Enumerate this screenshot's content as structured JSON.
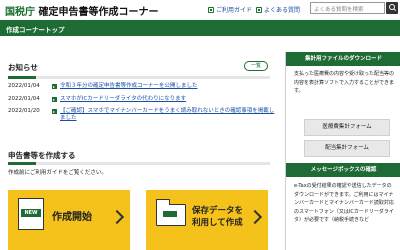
{
  "header": {
    "agency": "国税庁",
    "site_title": "確定申告書等作成コーナー",
    "guide_link": "ご利用ガイド",
    "faq_link": "よくある質問",
    "search_placeholder": "よくある質問を検索"
  },
  "topbar": {
    "title": "作成コーナートップ"
  },
  "news": {
    "heading": "お知らせ",
    "list_button": "一覧",
    "items": [
      {
        "date": "2022/01/04",
        "text": "令和３年分の確定申告書等作成コーナーを公開しました"
      },
      {
        "date": "2022/01/04",
        "text": "スマホがICカードリーダライタの代わりになります"
      },
      {
        "date": "2022/01/20",
        "text": "【ご確認】スマホでマイナンバーカードをうまく読み取れないときの確認事項を掲載しました"
      }
    ]
  },
  "create": {
    "heading": "申告書等を作成する",
    "subtext": "作成前にご利用ガイドをご覧ください。",
    "tile_start": "作成開始",
    "tile_start_icon_text": "NEW",
    "tile_saved_line1": "保存データを",
    "tile_saved_line2": "利用して作成"
  },
  "sidebar": {
    "download_heading": "集計用ファイルのダウンロード",
    "download_text": "支払った医療費の内容や受け取った配当等の内容を表計算ソフトで入力することができます。",
    "btn_medical": "医療費集計フォーム",
    "btn_dividend": "配当集計フォーム",
    "message_heading": "メッセージボックスの確認",
    "message_text": "e-Taxの受付結果の確認や送信したデータのダウンロードができます。ご利用にはマイナンバーカードとマイナンバーカード読取対応のスマートフォン（又はICカードリーダライタ）が必要です（納税手続きなど"
  },
  "colors": {
    "brand_green": "#1f6b35",
    "tile_yellow": "#f5c21b",
    "link_blue": "#1a4fa8"
  }
}
